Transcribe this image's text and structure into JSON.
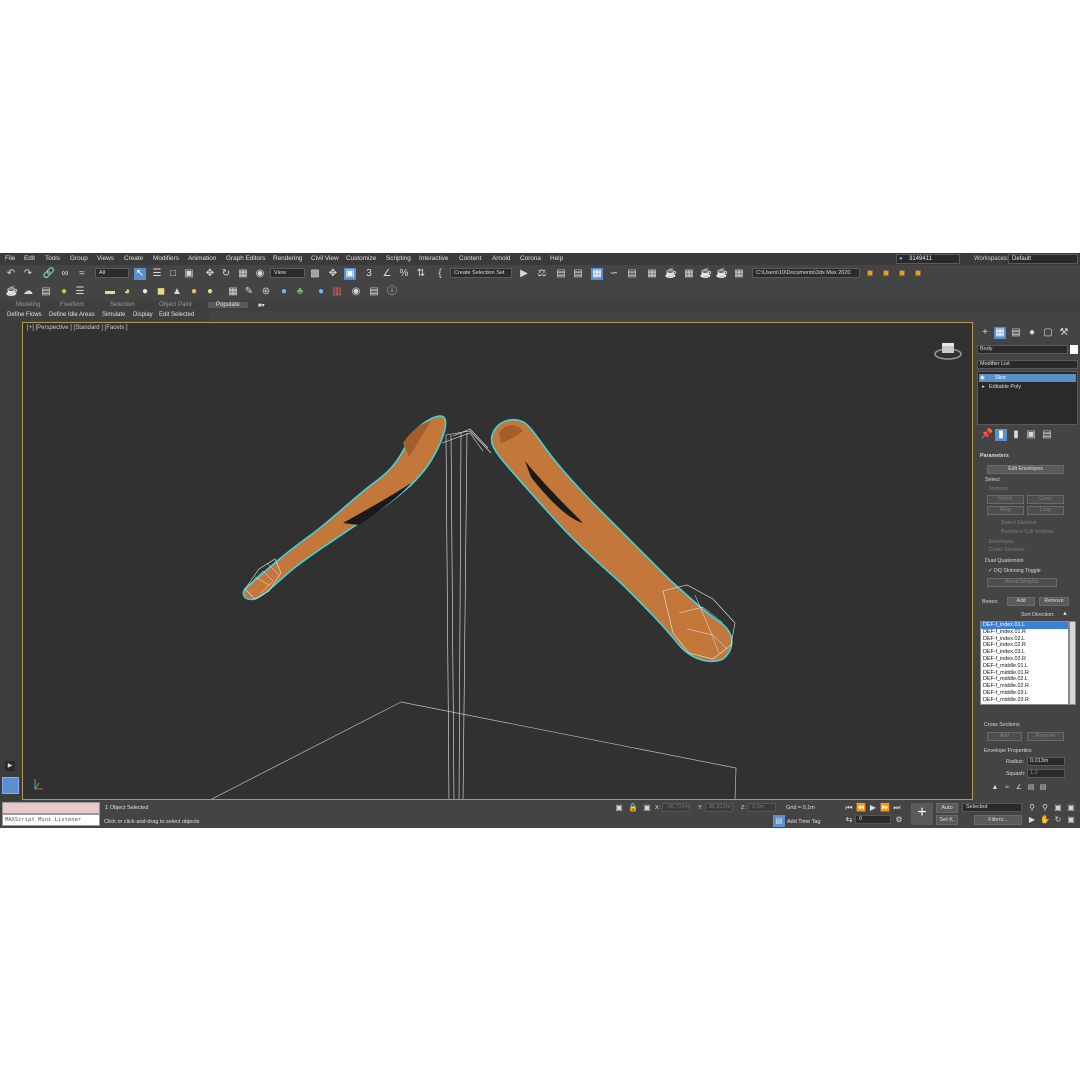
{
  "menu": [
    "File",
    "Edit",
    "Tools",
    "Group",
    "Views",
    "Create",
    "Modifiers",
    "Animation",
    "Graph Editors",
    "Rendering",
    "Civil View",
    "Customize",
    "Scripting",
    "Interactive",
    "Content",
    "Arnold",
    "Corona",
    "Help"
  ],
  "user": {
    "name": "3149411"
  },
  "workspace": {
    "label": "Workspaces:",
    "value": "Default"
  },
  "toolbar": {
    "filter_value": "All",
    "refcoord_value": "View",
    "selection_set": "Create Selection Set",
    "project_path": "C:\\Users\\10\\Documents\\3ds Max 2020"
  },
  "ribbon": {
    "tabs": [
      "Modeling",
      "Freeform",
      "Selection",
      "Object Paint",
      "Populate"
    ],
    "active_tab": "Populate",
    "commands": [
      "Define Flows",
      "Define Idle Areas",
      "Simulate",
      "Display",
      "Edit Selected"
    ]
  },
  "viewport": {
    "label": "[+] [Perspective ] [Standard ] [Facets ]"
  },
  "panel": {
    "object_name": "Body",
    "modifier_list": "Modifier List",
    "stack": [
      "Skin",
      "Editable Poly"
    ],
    "parameters": "Parameters",
    "edit_envelopes": "Edit Envelopes",
    "select_label": "Select",
    "vertices": "Vertices",
    "shrink": "Shrink",
    "grow": "Grow",
    "ring": "Ring",
    "loop": "Loop",
    "select_element": "Select Element",
    "backface_cull": "Backface Cull Vertices",
    "envelopes": "Envelopes",
    "cross_sections": "Cross Sections",
    "dual_quaternion": "Dual Quaternion",
    "dq_toggle": "DQ Skinning Toggle",
    "blend_weights": "Blend Weights",
    "bones_label": "Bones:",
    "add": "Add",
    "remove": "Remove",
    "sort_direction": "Sort Direction:",
    "bones": [
      "DEF-f_index.01.L",
      "DEF-f_index.01.R",
      "DEF-f_index.02.L",
      "DEF-f_index.02.R",
      "DEF-f_index.03.L",
      "DEF-f_index.03.R",
      "DEF-f_middle.01.L",
      "DEF-f_middle.01.R",
      "DEF-f_middle.02.L",
      "DEF-f_middle.02.R",
      "DEF-f_middle.03.L",
      "DEF-f_middle.03.R"
    ],
    "cross_sections_group": "Cross Sections",
    "cs_add": "Add",
    "cs_remove": "Remove",
    "envelope_properties": "Envelope Properties",
    "radius_label": "Radius:",
    "radius_value": "0,013m",
    "squash_label": "Squash:",
    "squash_value": "1,0"
  },
  "status": {
    "maxscript": "MAXScript Mini Listener",
    "selected": "1 Object Selected",
    "prompt": "Click or click-and-drag to select objects",
    "x_label": "X:",
    "x_value": "-36,716m",
    "y_label": "Y:",
    "y_value": "86,813m",
    "z_label": "Z:",
    "z_value": "0,0m",
    "grid": "Grid = 0,1m",
    "add_time_tag": "Add Time Tag",
    "frame": "0",
    "auto": "Auto",
    "setk": "Set K.",
    "selected_dd": "Selected",
    "filters": "Filters..."
  },
  "colors": {
    "accent": "#5b8fc9",
    "viewport_border": "#b19b4e",
    "skin": "#c4773a",
    "outline": "#3fd3d8"
  }
}
